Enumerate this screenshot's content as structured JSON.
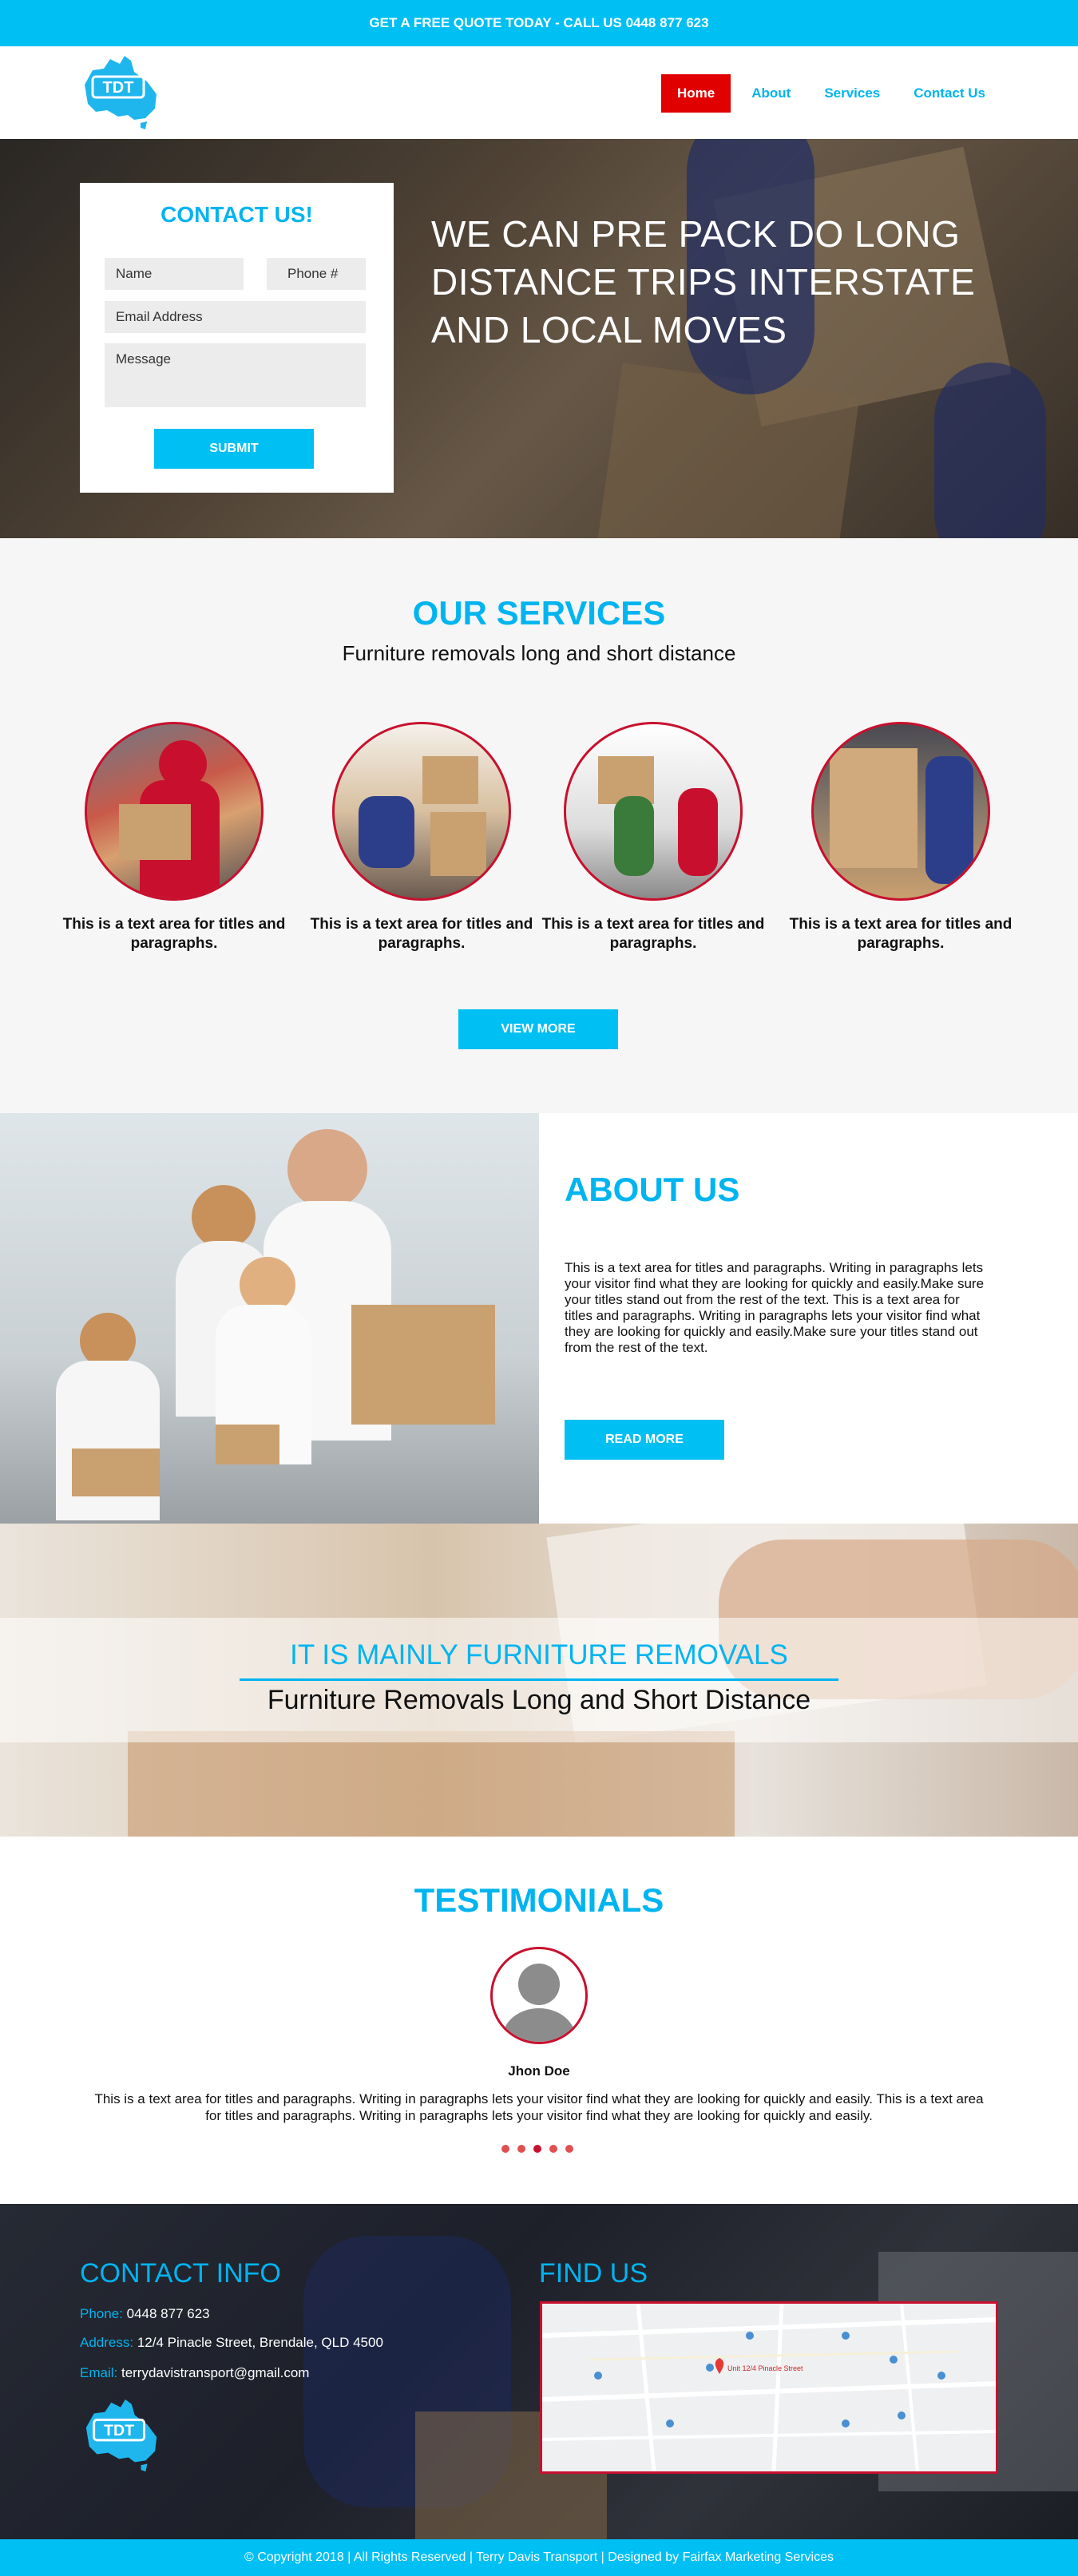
{
  "topbar": {
    "text": "GET A FREE QUOTE TODAY  -  CALL US  0448 877 623"
  },
  "brand": {
    "logo_text": "TDT",
    "accent": "#00bff3",
    "red": "#c8102e"
  },
  "nav": {
    "items": [
      "Home",
      "About",
      "Services",
      "Contact Us"
    ],
    "active": "Home"
  },
  "hero": {
    "headline": "WE CAN PRE PACK DO LONG DISTANCE TRIPS INTERSTATE AND LOCAL MOVES",
    "form": {
      "title": "CONTACT US!",
      "name_placeholder": "Name",
      "phone_placeholder": "Phone #",
      "email_placeholder": "Email Address",
      "message_placeholder": "Message",
      "submit": "SUBMIT"
    }
  },
  "services": {
    "title": "OUR SERVICES",
    "subtitle": "Furniture removals long and short distance",
    "items": [
      {
        "text": "This is a text area for titles and paragraphs."
      },
      {
        "text": "This is a text area for titles and paragraphs."
      },
      {
        "text": "This is a text area for titles and paragraphs."
      },
      {
        "text": "This is a text area for titles and paragraphs."
      }
    ],
    "button": "VIEW MORE"
  },
  "about": {
    "title": "ABOUT US",
    "body": "This is a text area for titles and paragraphs. Writing in paragraphs lets your visitor find what they are looking for quickly and easily.Make sure your titles stand out from the rest of the text. This is a text area for titles and paragraphs. Writing in paragraphs lets your visitor find what they are looking for quickly and easily.Make sure your titles stand out from the rest of the text.",
    "button": "READ MORE"
  },
  "banner": {
    "title": "IT IS MAINLY FURNITURE REMOVALS",
    "subtitle": "Furniture Removals Long and Short Distance"
  },
  "testimonials": {
    "title": "TESTIMONIALS",
    "name": "Jhon Doe",
    "text": "This is a text area for titles and paragraphs. Writing in paragraphs lets your visitor find what they are looking for quickly and easily. This is a text area for titles and paragraphs. Writing in paragraphs lets your visitor find what they are looking for quickly and easily.",
    "active_dot": 2
  },
  "footer": {
    "contact_title": "CONTACT INFO",
    "phone_label": "Phone:",
    "phone": "0448 877 623",
    "address_label": "Address:",
    "address": "12/4 Pinacle Street, Brendale, QLD 4500",
    "email_label": "Email:",
    "email": "terrydavistransport@gmail.com",
    "find_title": "FIND US",
    "map_pin_label": "Unit 12/4 Pinacle Street",
    "copyright": "© Copyright 2018 | All Rights Reserved | Terry Davis Transport | Designed by Fairfax Marketing Services"
  }
}
